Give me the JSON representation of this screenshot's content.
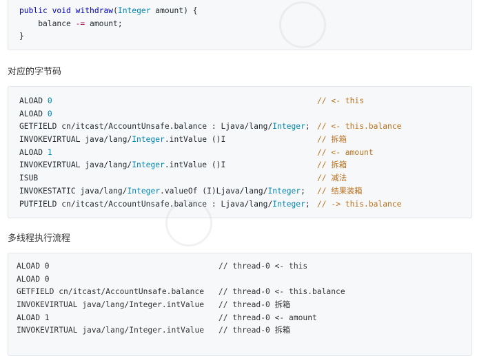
{
  "block1": {
    "lines": [
      {
        "parts": [
          [
            "kw",
            "public"
          ],
          [
            "t",
            " "
          ],
          [
            "kw",
            "void"
          ],
          [
            "t",
            " "
          ],
          [
            "fn",
            "withdraw"
          ],
          [
            "t",
            "("
          ],
          [
            "ty",
            "Integer"
          ],
          [
            "t",
            " amount) {"
          ]
        ]
      },
      {
        "parts": [
          [
            "t",
            "    balance "
          ],
          [
            "op",
            "-="
          ],
          [
            "t",
            " amount;"
          ]
        ]
      },
      {
        "parts": [
          [
            "t",
            "}"
          ]
        ]
      }
    ]
  },
  "heading1": "对应的字节码",
  "block2": {
    "lines": [
      {
        "code": [
          [
            "t",
            "ALOAD "
          ],
          [
            "num",
            "0"
          ]
        ],
        "comment": "// <- this"
      },
      {
        "code": [
          [
            "t",
            "ALOAD "
          ],
          [
            "num",
            "0"
          ]
        ],
        "comment": ""
      },
      {
        "code": [
          [
            "t",
            "GETFIELD cn/itcast/AccountUnsafe.balance : Ljava/lang/"
          ],
          [
            "cls",
            "Integer"
          ],
          [
            "t",
            ";"
          ]
        ],
        "comment": "// <- this.balance"
      },
      {
        "code": [
          [
            "t",
            "INVOKEVIRTUAL java/lang/"
          ],
          [
            "cls",
            "Integer"
          ],
          [
            "t",
            ".intValue ()I"
          ]
        ],
        "comment": "// 拆箱"
      },
      {
        "code": [
          [
            "t",
            "ALOAD "
          ],
          [
            "num",
            "1"
          ]
        ],
        "comment": "// <- amount"
      },
      {
        "code": [
          [
            "t",
            "INVOKEVIRTUAL java/lang/"
          ],
          [
            "cls",
            "Integer"
          ],
          [
            "t",
            ".intValue ()I"
          ]
        ],
        "comment": "// 拆箱"
      },
      {
        "code": [
          [
            "t",
            "ISUB"
          ]
        ],
        "comment": "// 减法"
      },
      {
        "code": [
          [
            "t",
            "INVOKESTATIC java/lang/"
          ],
          [
            "cls",
            "Integer"
          ],
          [
            "t",
            ".valueOf (I)Ljava/lang/"
          ],
          [
            "cls",
            "Integer"
          ],
          [
            "t",
            ";"
          ]
        ],
        "comment": "// 结果装箱"
      },
      {
        "code": [
          [
            "t",
            "PUTFIELD cn/itcast/AccountUnsafe.balance : Ljava/lang/"
          ],
          [
            "cls",
            "Integer"
          ],
          [
            "t",
            ";"
          ]
        ],
        "comment": "// -> this.balance"
      }
    ]
  },
  "heading2": "多线程执行流程",
  "block3": {
    "lines": [
      {
        "code": "ALOAD 0",
        "comment": "// thread-0 <- this"
      },
      {
        "code": "ALOAD 0",
        "comment": ""
      },
      {
        "code": "GETFIELD cn/itcast/AccountUnsafe.balance",
        "comment": "// thread-0 <- this.balance"
      },
      {
        "code": "INVOKEVIRTUAL java/lang/Integer.intValue",
        "comment": "// thread-0 拆箱"
      },
      {
        "code": "ALOAD 1",
        "comment": "// thread-0 <- amount"
      },
      {
        "code": "INVOKEVIRTUAL java/lang/Integer.intValue",
        "comment": "// thread-0 拆箱"
      }
    ]
  }
}
